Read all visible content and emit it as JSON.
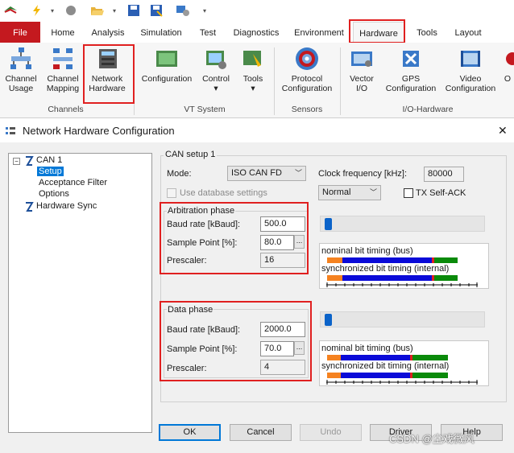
{
  "tabs": [
    "File",
    "Home",
    "Analysis",
    "Simulation",
    "Test",
    "Diagnostics",
    "Environment",
    "Hardware",
    "Tools",
    "Layout"
  ],
  "ribbon": {
    "buttons": [
      {
        "label": "Channel\nUsage",
        "icon": "channel-usage-icon"
      },
      {
        "label": "Channel\nMapping",
        "icon": "channel-mapping-icon"
      },
      {
        "label": "Network\nHardware",
        "icon": "network-hardware-icon"
      },
      {
        "label": "Configuration",
        "icon": "vt-configuration-icon"
      },
      {
        "label": "Control",
        "icon": "vt-control-icon"
      },
      {
        "label": "Tools",
        "icon": "vt-tools-icon"
      },
      {
        "label": "Protocol\nConfiguration",
        "icon": "protocol-configuration-icon"
      },
      {
        "label": "Vector\nI/O",
        "icon": "vector-io-icon"
      },
      {
        "label": "GPS\nConfiguration",
        "icon": "gps-configuration-icon"
      },
      {
        "label": "Video\nConfiguration",
        "icon": "video-configuration-icon"
      },
      {
        "label": "O",
        "icon": "more-icon"
      }
    ],
    "groups": [
      "Channels",
      "VT System",
      "Sensors",
      "I/O-Hardware"
    ],
    "control_dropdown": "▾",
    "tools_dropdown": "▾"
  },
  "dialog": {
    "title": "Network Hardware Configuration",
    "close": "✕",
    "tree": {
      "root": "CAN 1",
      "children": [
        "Setup",
        "Acceptance Filter",
        "Options"
      ],
      "sibling": "Hardware Sync"
    },
    "setup": {
      "group_title": "CAN setup 1",
      "mode_label": "Mode:",
      "mode_value": "ISO CAN FD",
      "clock_label": "Clock frequency [kHz]:",
      "clock_value": "80000",
      "use_db_label": "Use database settings",
      "use_db_checked": false,
      "normal_value": "Normal",
      "tx_self_ack_label": "TX Self-ACK",
      "tx_self_ack_checked": false
    },
    "arbitration": {
      "title": "Arbitration phase",
      "baud_label": "Baud rate [kBaud]:",
      "baud_value": "500.0",
      "sample_label": "Sample Point [%]:",
      "sample_value": "80.0",
      "prescaler_label": "Prescaler:",
      "prescaler_value": "16",
      "nominal_label": "nominal bit timing (bus)",
      "sync_label": "synchronized bit timing (internal)",
      "slider_position": 0.02
    },
    "data_phase": {
      "title": "Data phase",
      "baud_label": "Baud rate [kBaud]:",
      "baud_value": "2000.0",
      "sample_label": "Sample Point [%]:",
      "sample_value": "70.0",
      "prescaler_label": "Prescaler:",
      "prescaler_value": "4",
      "nominal_label": "nominal bit timing (bus)",
      "sync_label": "synchronized bit timing (internal)",
      "slider_position": 0.02
    },
    "ellipsis": "...",
    "buttons": {
      "ok": "OK",
      "cancel": "Cancel",
      "undo": "Undo",
      "driver": "Driver",
      "help": "Help"
    }
  },
  "watermark": "CSDN @尘戏微风",
  "colors": {
    "file_tab": "#c4191f",
    "highlight": "#e02020",
    "sync_seg": "#f58220",
    "prop_seg": "#0a0ad8",
    "phase1": "#0a0ad8",
    "sample_mark": "#e02020",
    "phase2": "#0a8a0a"
  }
}
